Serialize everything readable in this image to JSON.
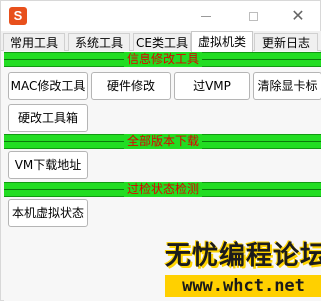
{
  "app": {
    "icon_glyph": "S",
    "accent": "#e8501c"
  },
  "titlebar": {
    "close_glyph": "✕"
  },
  "tabs": [
    {
      "label": "常用工具",
      "active": false
    },
    {
      "label": "系统工具",
      "active": false
    },
    {
      "label": "CE类工具",
      "active": false
    },
    {
      "label": "虚拟机类",
      "active": true
    },
    {
      "label": "更新日志",
      "active": false
    }
  ],
  "sections": {
    "info_modify": {
      "title": "信息修改工具",
      "buttons": [
        "MAC修改工具",
        "硬件修改",
        "过VMP",
        "清除显卡标",
        "硬改工具箱"
      ]
    },
    "downloads": {
      "title": "全部版本下载",
      "buttons": [
        "VM下载地址"
      ]
    },
    "detection": {
      "title": "过检状态检测",
      "buttons": [
        "本机虚拟状态"
      ]
    }
  },
  "colors": {
    "section_bar": "#22dd22",
    "section_title": "#e00000"
  },
  "watermark": {
    "line1": "无忧编程论坛",
    "line2": "www.whct.net"
  }
}
